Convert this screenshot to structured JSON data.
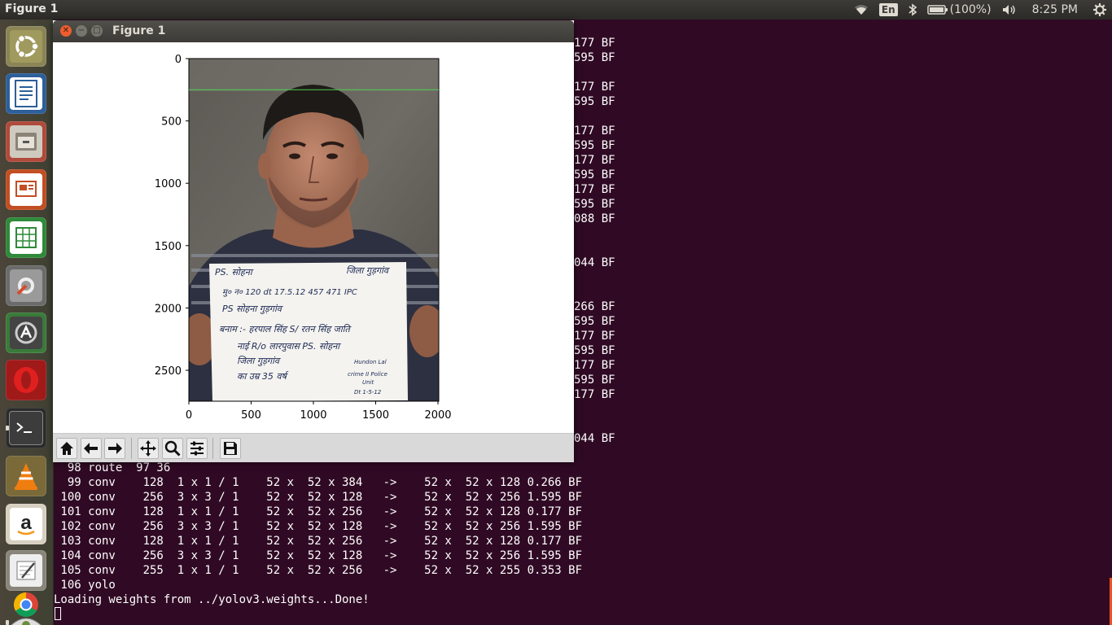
{
  "top_panel": {
    "app_title": "Figure 1",
    "keyboard_layout": "En",
    "battery_text": "(100%)",
    "clock": "8:25 PM",
    "icons": [
      "wifi-icon",
      "keyboard-layout-indicator",
      "bluetooth-icon",
      "battery-icon",
      "volume-icon",
      "settings-gear-icon"
    ]
  },
  "launcher": {
    "items": [
      "ubuntu-dash",
      "libreoffice-writer",
      "files",
      "libreoffice-impress",
      "libreoffice-calc",
      "system-settings",
      "software-updater",
      "opera",
      "terminal",
      "vlc",
      "amazon",
      "text-editor",
      "chrome",
      "image-viewer"
    ]
  },
  "figure_window": {
    "title": "Figure 1",
    "toolbar": [
      "home-icon",
      "back-arrow-icon",
      "forward-arrow-icon",
      "pan-icon",
      "zoom-icon",
      "configure-subplots-icon",
      "save-icon"
    ]
  },
  "chart_data": {
    "type": "image",
    "x_ticks": [
      "0",
      "500",
      "1000",
      "1500",
      "2000"
    ],
    "y_ticks": [
      "0",
      "500",
      "1000",
      "1500",
      "2000",
      "2500"
    ],
    "xlim": [
      0,
      2000
    ],
    "ylim_inverted": [
      0,
      2750
    ],
    "overlay_line_y": 250,
    "overlay_line_color": "#4cd14c"
  },
  "photo": {
    "sign_lines": [
      "PS. सोहना",
      "जिला गुड़गांव",
      "मु० न० 120 dt 17.5.12 457 471 IPC",
      "PS सोहना गुड़गांव",
      "बनाम :- हरपाल सिंह S/ रतन सिंह जाति",
      "नाई R/o लारपुवास PS. सोहना",
      "जिला गुड़गांव",
      "का उम्र 35 वर्ष",
      "Hundon Lal",
      "crime II Police",
      "Unit",
      "Dt 1-5-12"
    ]
  },
  "terminal": {
    "top_lines": [
      {
        "row": 0,
        "text": "177 BF"
      },
      {
        "row": 1,
        "text": "595 BF"
      },
      {
        "row": 3,
        "text": "177 BF"
      },
      {
        "row": 4,
        "text": "595 BF"
      },
      {
        "row": 6,
        "text": "177 BF"
      },
      {
        "row": 7,
        "text": "595 BF"
      },
      {
        "row": 8,
        "text": "177 BF"
      },
      {
        "row": 9,
        "text": "595 BF"
      },
      {
        "row": 10,
        "text": "177 BF"
      },
      {
        "row": 11,
        "text": "595 BF"
      },
      {
        "row": 12,
        "text": "088 BF"
      },
      {
        "row": 15,
        "text": "044 BF"
      },
      {
        "row": 18,
        "text": "266 BF"
      },
      {
        "row": 19,
        "text": "595 BF"
      },
      {
        "row": 20,
        "text": "177 BF"
      },
      {
        "row": 21,
        "text": "595 BF"
      },
      {
        "row": 22,
        "text": "177 BF"
      },
      {
        "row": 23,
        "text": "595 BF"
      },
      {
        "row": 24,
        "text": "177 BF"
      },
      {
        "row": 27,
        "text": "044 BF"
      }
    ],
    "bottom_lines": [
      "  98 route  97 36",
      "  99 conv    128  1 x 1 / 1    52 x  52 x 384   ->    52 x  52 x 128 0.266 BF",
      " 100 conv    256  3 x 3 / 1    52 x  52 x 128   ->    52 x  52 x 256 1.595 BF",
      " 101 conv    128  1 x 1 / 1    52 x  52 x 256   ->    52 x  52 x 128 0.177 BF",
      " 102 conv    256  3 x 3 / 1    52 x  52 x 128   ->    52 x  52 x 256 1.595 BF",
      " 103 conv    128  1 x 1 / 1    52 x  52 x 256   ->    52 x  52 x 128 0.177 BF",
      " 104 conv    256  3 x 3 / 1    52 x  52 x 128   ->    52 x  52 x 256 1.595 BF",
      " 105 conv    255  1 x 1 / 1    52 x  52 x 256   ->    52 x  52 x 255 0.353 BF",
      " 106 yolo"
    ],
    "loading_line": "Loading weights from ../yolov3.weights...Done!"
  }
}
